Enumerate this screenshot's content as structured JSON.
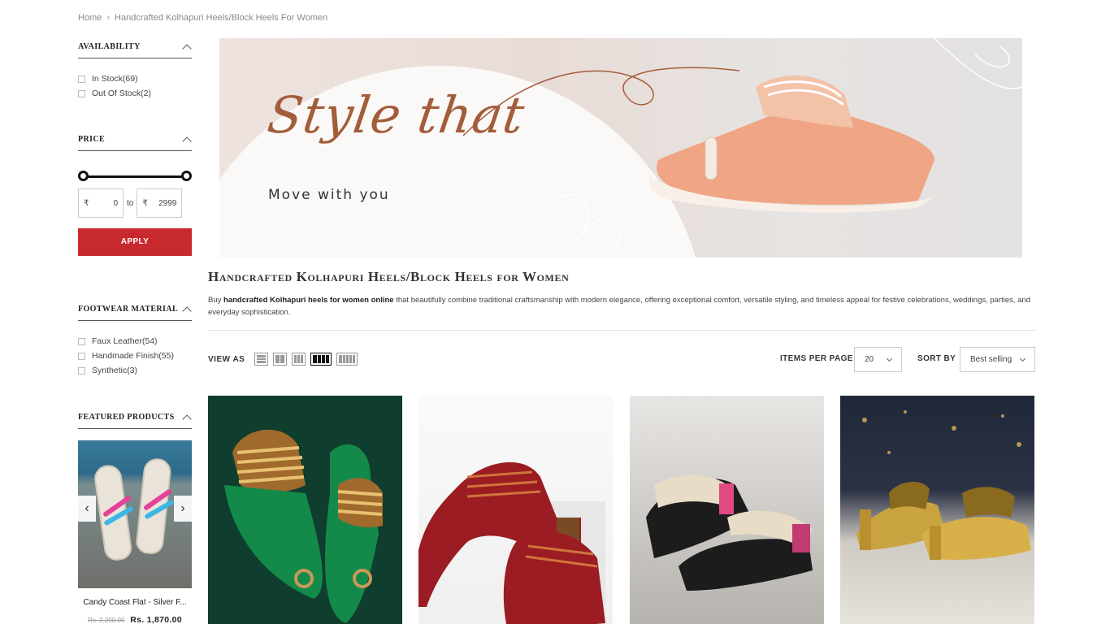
{
  "breadcrumb": {
    "home": "Home",
    "separator": "›",
    "current": "Handcrafted Kolhapuri Heels/Block Heels For Women"
  },
  "sidebar": {
    "availability": {
      "title": "AVAILABILITY",
      "options": [
        "In Stock(69)",
        "Out Of Stock(2)"
      ]
    },
    "price": {
      "title": "PRICE",
      "currency": "₹",
      "min": "0",
      "max": "2999",
      "to_label": "to",
      "apply_label": "APPLY"
    },
    "material": {
      "title": "FOOTWEAR MATERIAL",
      "options": [
        "Faux Leather(54)",
        "Handmade Finish(55)",
        "Synthetic(3)"
      ]
    },
    "featured": {
      "title": "FEATURED PRODUCTS",
      "product_title": "Candy Coast Flat - Silver F...",
      "old_price": "Rs. 2,200.00",
      "price": "Rs. 1,870.00",
      "prev": "‹",
      "next": "›"
    }
  },
  "banner": {
    "script_text": "Style that",
    "tagline": "Move with you"
  },
  "category": {
    "title": "Handcrafted Kolhapuri Heels/Block Heels for Women",
    "desc_prefix": "Buy ",
    "desc_bold": "handcrafted Kolhapuri heels for women online",
    "desc_rest": " that beautifully combine traditional craftsmanship with modern elegance, offering exceptional comfort, versatile styling, and timeless appeal for festive celebrations, weddings, parties, and everyday sophistication."
  },
  "toolbar": {
    "view_as": "VIEW AS",
    "items_per_page_label": "ITEMS PER PAGE",
    "items_per_page": "20",
    "sort_label": "SORT BY",
    "sort_value": "Best selling"
  },
  "colors": {
    "apply_button": "#c8292f",
    "banner_script": "#a35d3a"
  }
}
